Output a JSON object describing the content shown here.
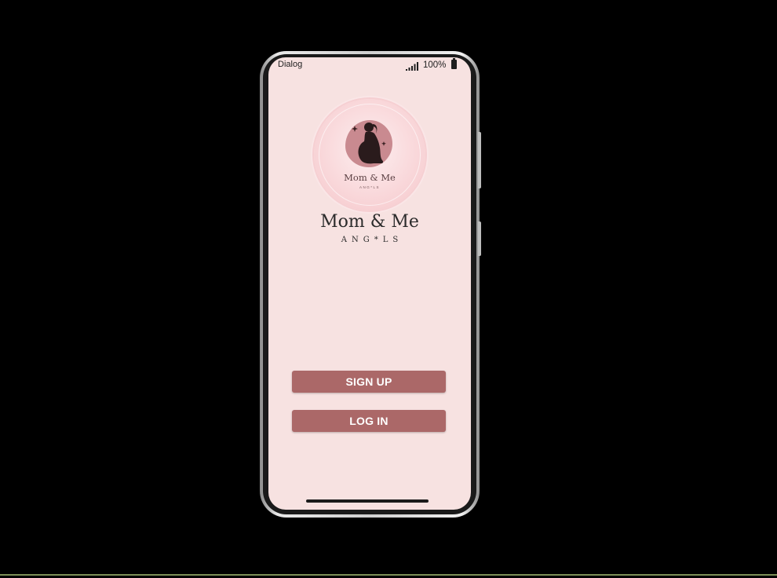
{
  "status_bar": {
    "title": "Dialog",
    "battery": "100%",
    "icons": [
      "signal-icon",
      "battery-icon"
    ]
  },
  "logo": {
    "badge_title": "Mom & Me",
    "badge_subtitle": "ANG*LS",
    "icon": "pregnant-woman-silhouette-icon"
  },
  "brand": {
    "title": "Mom & Me",
    "subtitle": "ANG*LS"
  },
  "actions": {
    "signup_label": "SIGN UP",
    "login_label": "LOG IN"
  },
  "colors": {
    "background": "#f7e2e1",
    "button": "#ab6868",
    "button_text": "#ffffff",
    "text": "#2b2b2b"
  }
}
